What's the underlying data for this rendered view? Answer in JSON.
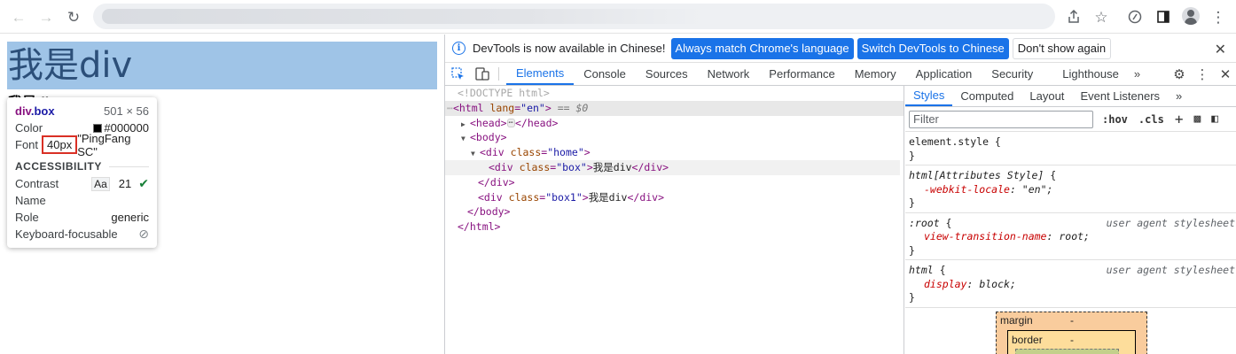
{
  "page": {
    "box_text": "我是div",
    "box1_text": "我是div"
  },
  "tooltip": {
    "element_tag": "div",
    "element_class": ".box",
    "dimensions": "501 × 56",
    "color_label": "Color",
    "color_value": "#000000",
    "font_label": "Font",
    "font_size": "40px",
    "font_family": "\"PingFang SC\"",
    "section": "ACCESSIBILITY",
    "contrast_label": "Contrast",
    "contrast_aa": "Aa",
    "contrast_value": "21",
    "name_label": "Name",
    "role_label": "Role",
    "role_value": "generic",
    "focusable_label": "Keyboard-focusable"
  },
  "devtools": {
    "infobar": {
      "message": "DevTools is now available in Chinese!",
      "btn_match": "Always match Chrome's language",
      "btn_switch": "Switch DevTools to Chinese",
      "btn_dismiss": "Don't show again"
    },
    "tabs": [
      "Elements",
      "Console",
      "Sources",
      "Network",
      "Performance",
      "Memory",
      "Application",
      "Security",
      "Lighthouse"
    ],
    "active_tab": "Elements",
    "dom": {
      "doctype": "<!DOCTYPE html>",
      "html_open_tag": "<html",
      "html_attr": "lang",
      "html_attr_val": "\"en\"",
      "html_sel_marker": "== $0",
      "head_open": "<head>",
      "head_close": "</head>",
      "body_open": "<body>",
      "home_div_open": "<div",
      "class_attr": "class",
      "home_class_val": "\"home\"",
      "box_class_val": "\"box\"",
      "box1_class_val": "\"box1\"",
      "div_text": "我是div",
      "div_close": "</div>",
      "body_close": "</body>",
      "html_close": "</html>"
    },
    "styles": {
      "tabs": [
        "Styles",
        "Computed",
        "Layout",
        "Event Listeners"
      ],
      "active_tab": "Styles",
      "filter_placeholder": "Filter",
      "hov": ":hov",
      "cls": ".cls",
      "rules": {
        "element_style": "element.style {",
        "attr_style_sel": "html[Attributes Style]",
        "attr_style_prop": "-webkit-locale",
        "attr_style_val": "\"en\"",
        "root_sel": ":root",
        "root_prop": "view-transition-name",
        "root_val": "root",
        "html_sel": "html",
        "html_prop": "display",
        "html_val": "block",
        "ua_source": "user agent stylesheet"
      },
      "boxmodel": {
        "margin_label": "margin",
        "margin_value": "-",
        "border_label": "border",
        "border_value": "-"
      }
    }
  },
  "colors": {
    "accent": "#1a73e8",
    "highlight": "#9fc4e7",
    "margin": "#f9cc9d",
    "border": "#fddd9b",
    "padding": "#c3d08b"
  }
}
